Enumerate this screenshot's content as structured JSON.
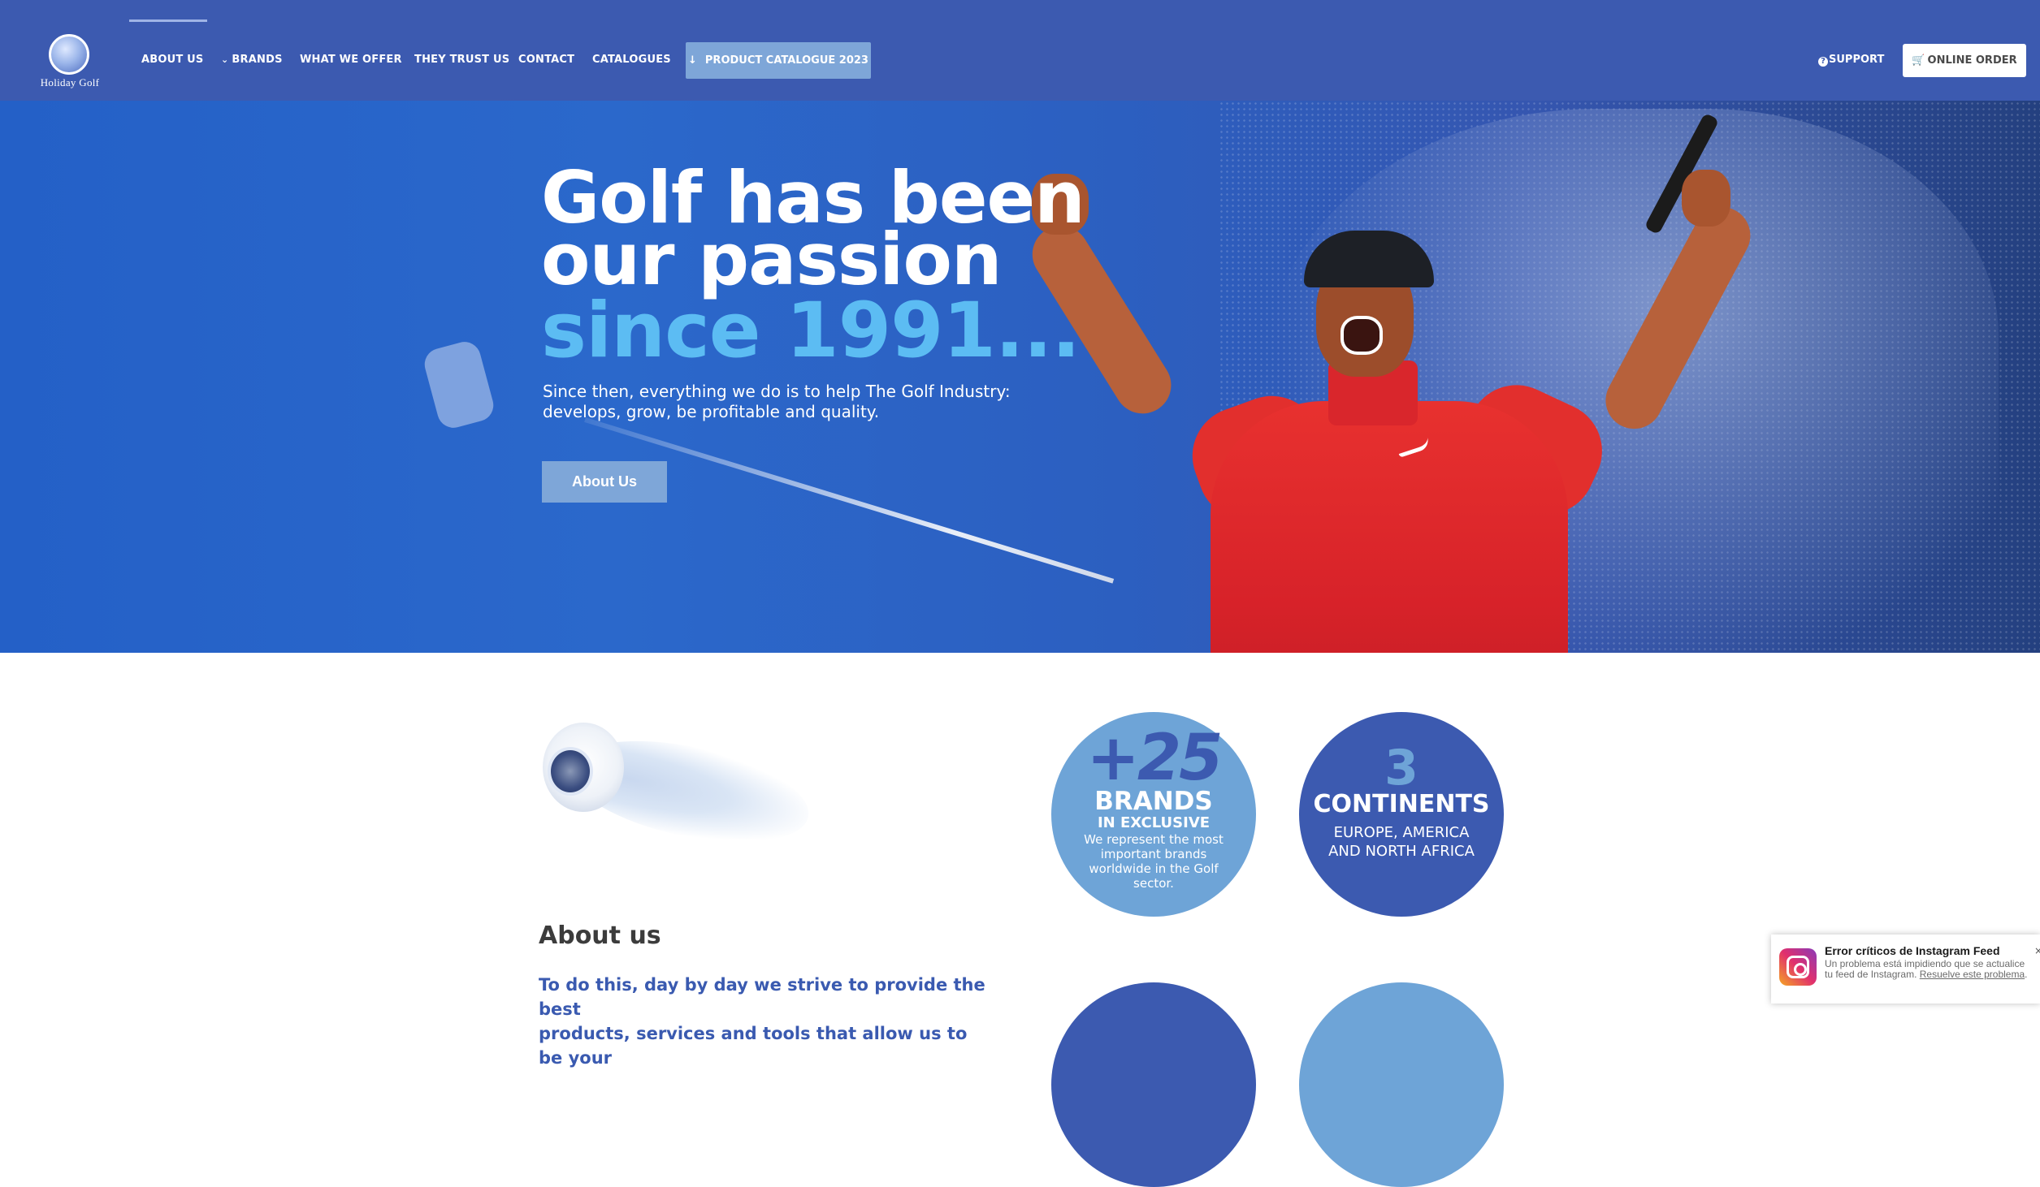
{
  "brand": {
    "logo_text": "Holiday Golf"
  },
  "nav": {
    "items": [
      {
        "label": "ABOUT US"
      },
      {
        "label": "BRANDS"
      },
      {
        "label": "WHAT WE OFFER"
      },
      {
        "label": "THEY TRUST US"
      },
      {
        "label": "CONTACT"
      },
      {
        "label": "CATALOGUES"
      }
    ],
    "catalogue_button": "PRODUCT CATALOGUE 2023",
    "catalogue_icon": "arrow-down-icon",
    "support_label": "SUPPORT",
    "support_icon": "question-circle-icon",
    "order_button": "ONLINE ORDER",
    "order_icon": "cart-icon"
  },
  "hero": {
    "title_line1": "Golf has been",
    "title_line2": "our passion",
    "title_accent": "since 1991...",
    "subtitle_line1": "Since then, everything we do is to help The Golf Industry:",
    "subtitle_line2": "develops, grow, be profitable and quality.",
    "button": "About Us"
  },
  "about": {
    "title": "About us",
    "text_line1": "To do this, day by day we strive to provide the best",
    "text_line2": "products, services and tools that allow us to be your"
  },
  "stats": {
    "brands": {
      "number": "+25",
      "label": "BRANDS",
      "sublabel": "IN EXCLUSIVE",
      "description": "We represent the most important brands worldwide in the Golf sector."
    },
    "continents": {
      "number": "3",
      "label": "CONTINENTS",
      "description_line1": "EUROPE, AMERICA",
      "description_line2": "AND NORTH AFRICA"
    }
  },
  "toast": {
    "title": "Error críticos de Instagram Feed",
    "body": "Un problema está impidiendo que se actualice tu feed de Instagram.",
    "link": "Resuelve este problema",
    "icon": "instagram-icon",
    "close": "×"
  },
  "colors": {
    "nav_bg": "#3c5ab0",
    "accent_light": "#7ea6d8",
    "hero_accent": "#5cbcf3",
    "circle_light": "#6ea4d7",
    "circle_dark": "#3c5ab0"
  }
}
